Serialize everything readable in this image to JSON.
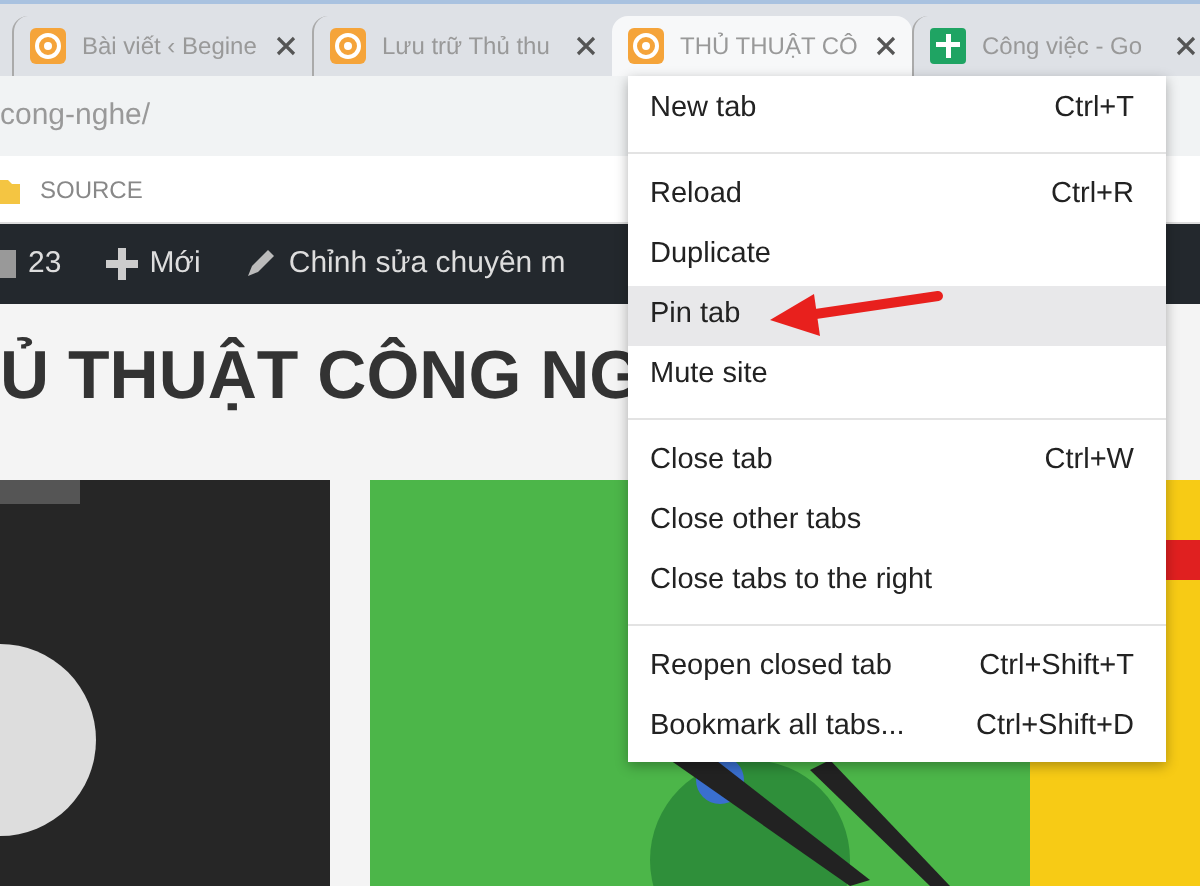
{
  "tabs": [
    {
      "title": "Bài viết ‹ Begine",
      "kind": "site",
      "selected": false
    },
    {
      "title": "Lưu trữ Thủ thu",
      "kind": "site",
      "selected": false
    },
    {
      "title": "THỦ THUẬT CÔ",
      "kind": "site",
      "selected": true
    },
    {
      "title": "Công việc - Go",
      "kind": "sheet",
      "selected": false
    }
  ],
  "address_bar": {
    "value": "cong-nghe/"
  },
  "bookmarks": [
    {
      "label": "SOURCE"
    }
  ],
  "admin_bar": {
    "comments": "23",
    "new": "Mới",
    "edit": "Chỉnh sửa chuyên m"
  },
  "page_heading": "Ủ THUẬT CÔNG NG",
  "context_menu": {
    "groups": [
      [
        {
          "label": "New tab",
          "shortcut": "Ctrl+T",
          "selected": false
        }
      ],
      [
        {
          "label": "Reload",
          "shortcut": "Ctrl+R",
          "selected": false
        },
        {
          "label": "Duplicate",
          "selected": false
        },
        {
          "label": "Pin tab",
          "selected": true
        },
        {
          "label": "Mute site",
          "selected": false
        }
      ],
      [
        {
          "label": "Close tab",
          "shortcut": "Ctrl+W",
          "selected": false
        },
        {
          "label": "Close other tabs",
          "selected": false
        },
        {
          "label": "Close tabs to the right",
          "selected": false
        }
      ],
      [
        {
          "label": "Reopen closed tab",
          "shortcut": "Ctrl+Shift+T",
          "selected": false
        },
        {
          "label": "Bookmark all tabs...",
          "shortcut": "Ctrl+Shift+D",
          "selected": false
        }
      ]
    ]
  }
}
